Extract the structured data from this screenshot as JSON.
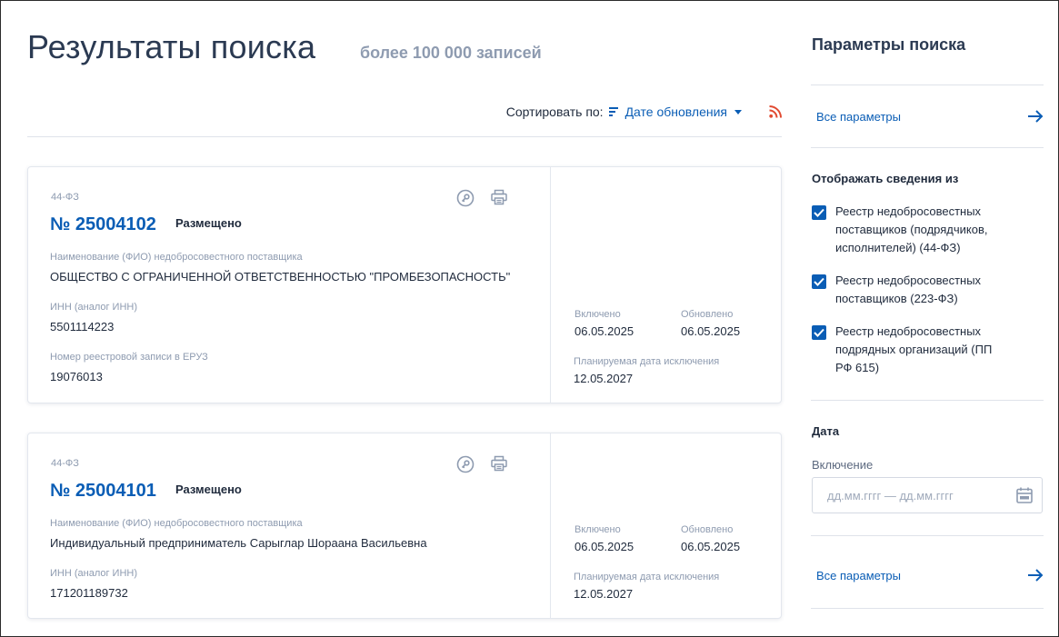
{
  "header": {
    "title": "Результаты поиска",
    "count": "более 100 000 записей"
  },
  "sort": {
    "label": "Сортировать по:",
    "value": "Дате обновления"
  },
  "icons": {
    "sort": "sort-lines-icon",
    "rss": "rss-icon",
    "key": "key-icon",
    "print": "printer-icon",
    "arrow": "arrow-right-icon",
    "calendar": "calendar-icon",
    "check": "checkmark-icon"
  },
  "colors": {
    "accent": "#0a5db5",
    "rss": "#e14b32",
    "muted": "#8e9bb0"
  },
  "results": [
    {
      "law": "44-ФЗ",
      "number": "№ 25004102",
      "status": "Размещено",
      "supplier_label": "Наименование (ФИО) недобросовестного поставщика",
      "supplier_value": "ОБЩЕСТВО С ОГРАНИЧЕННОЙ ОТВЕТСТВЕННОСТЬЮ \"ПРОМБЕЗОПАСНОСТЬ\"",
      "inn_label": "ИНН (аналог ИНН)",
      "inn_value": "5501114223",
      "eruz_label": "Номер реестровой записи в ЕРУЗ",
      "eruz_value": "19076013",
      "included_label": "Включено",
      "included_value": "06.05.2025",
      "updated_label": "Обновлено",
      "updated_value": "06.05.2025",
      "exclusion_label": "Планируемая дата исключения",
      "exclusion_value": "12.05.2027"
    },
    {
      "law": "44-ФЗ",
      "number": "№ 25004101",
      "status": "Размещено",
      "supplier_label": "Наименование (ФИО) недобросовестного поставщика",
      "supplier_value": "Индивидуальный предприниматель Сарыглар Шораана Васильевна",
      "inn_label": "ИНН (аналог ИНН)",
      "inn_value": "171201189732",
      "included_label": "Включено",
      "included_value": "06.05.2025",
      "updated_label": "Обновлено",
      "updated_value": "06.05.2025",
      "exclusion_label": "Планируемая дата исключения",
      "exclusion_value": "12.05.2027"
    }
  ],
  "sidebar": {
    "title": "Параметры поиска",
    "all_params": "Все параметры",
    "show_from_title": "Отображать сведения из",
    "registries": [
      "Реестр недобросовестных поставщиков (подрядчиков, исполнителей) (44-ФЗ)",
      "Реестр недобросовестных поставщиков (223-ФЗ)",
      "Реестр недобросовестных подрядных организаций (ПП РФ 615)"
    ],
    "date_title": "Дата",
    "inclusion_label": "Включение",
    "date_placeholder": "дд.мм.гггг — дд.мм.гггг",
    "all_params_bottom": "Все параметры"
  }
}
